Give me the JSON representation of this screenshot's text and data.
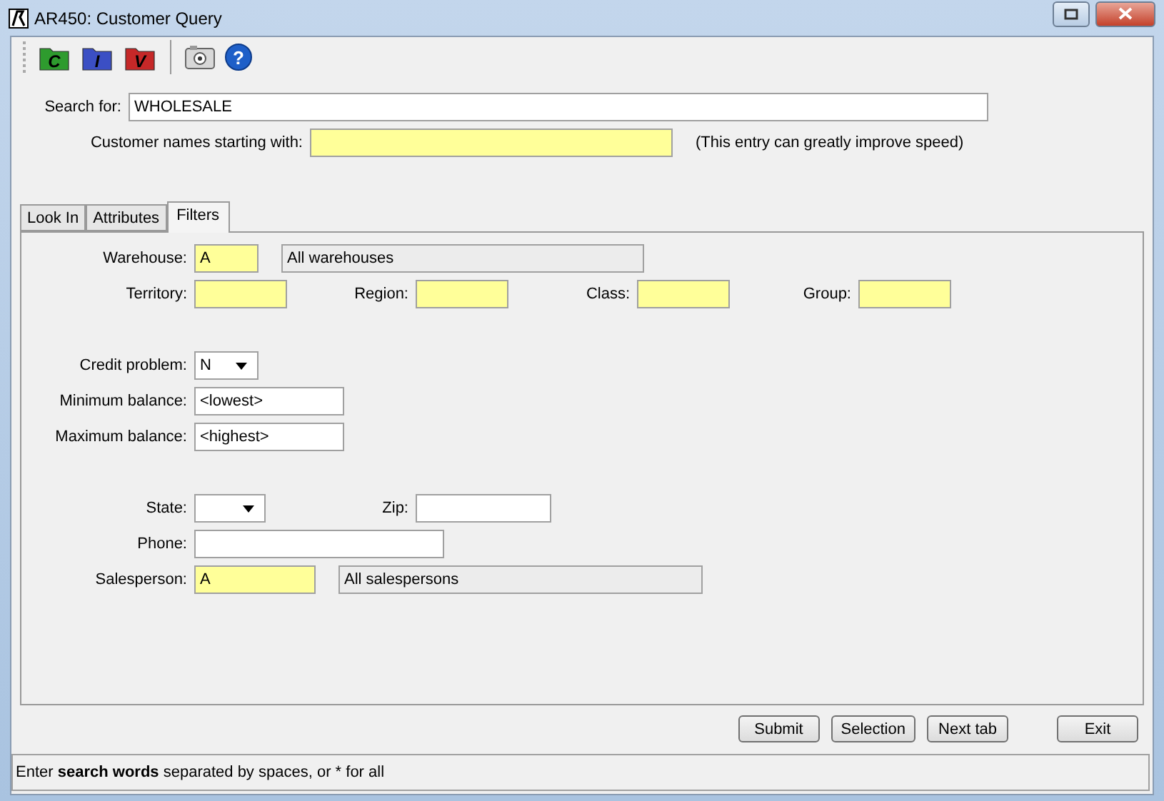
{
  "window": {
    "title": "AR450: Customer Query"
  },
  "toolbar": [
    {
      "kind": "folder",
      "label": "C",
      "color": "#2e9b2e"
    },
    {
      "kind": "folder",
      "label": "I",
      "color": "#3b4fc4"
    },
    {
      "kind": "folder",
      "label": "V",
      "color": "#c62828"
    },
    {
      "kind": "camera"
    },
    {
      "kind": "help",
      "label": "?"
    }
  ],
  "search": {
    "label": "Search for:",
    "value": "WHOLESALE",
    "required": false
  },
  "names": {
    "label": "Customer names starting with:",
    "required": true,
    "hint": "(This entry can greatly improve speed)"
  },
  "tabs": [
    {
      "label": "Look In",
      "selected": false
    },
    {
      "label": "Attributes",
      "selected": false
    },
    {
      "label": "Filters",
      "selected": true
    }
  ],
  "filters": {
    "warehouse": {
      "label": "Warehouse:",
      "value": "A",
      "required": true,
      "description": "All warehouses"
    },
    "territory": {
      "label": "Territory:",
      "required": true
    },
    "region": {
      "label": "Region:",
      "required": true
    },
    "class": {
      "label": "Class:",
      "required": true
    },
    "group": {
      "label": "Group:",
      "required": true
    },
    "credit_problem": {
      "label": "Credit problem:",
      "value": "N",
      "required": false
    },
    "minimum_balance": {
      "label": "Minimum balance:",
      "value": "<lowest>",
      "required": false
    },
    "maximum_balance": {
      "label": "Maximum balance:",
      "value": "<highest>",
      "required": false
    },
    "state": {
      "label": "State:",
      "required": false
    },
    "zip": {
      "label": "Zip:",
      "required": false
    },
    "phone": {
      "label": "Phone:",
      "required": false
    },
    "salesperson": {
      "label": "Salesperson:",
      "value": "A",
      "required": true,
      "description": "All salespersons"
    }
  },
  "buttons": [
    "Submit",
    "Selection",
    "Next tab",
    "Exit"
  ],
  "status_bar": "Enter **search words** separated by spaces, or * for all"
}
